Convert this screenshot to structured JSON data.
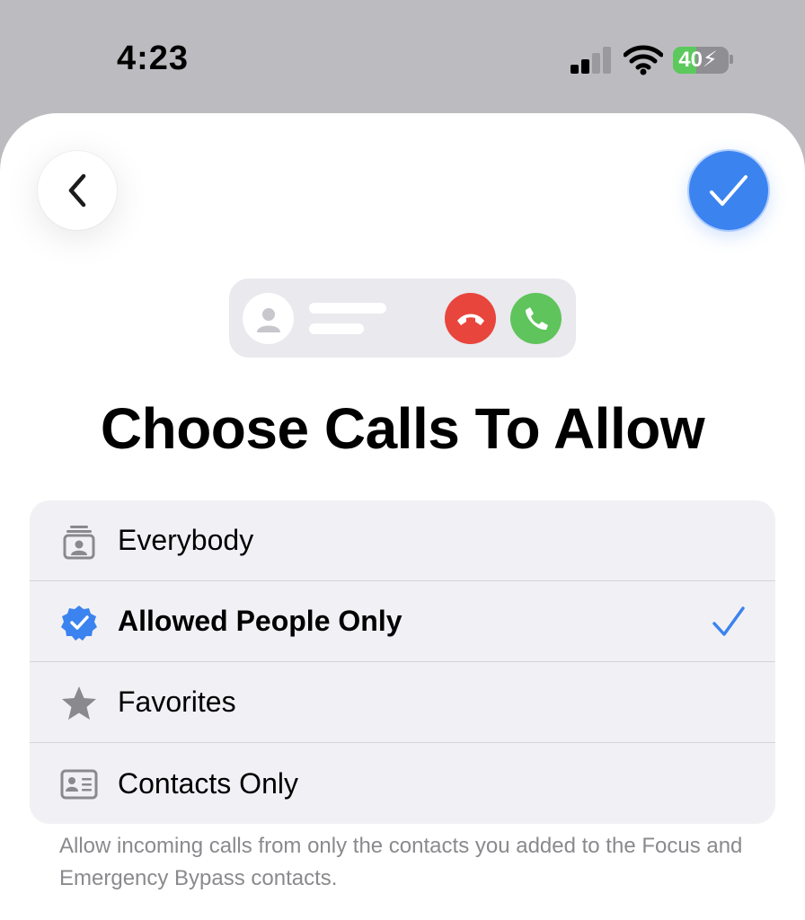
{
  "status_bar": {
    "time": "4:23",
    "battery_level": "40",
    "icons": [
      "cellular-signal-icon",
      "wifi-icon",
      "battery-charging-icon"
    ]
  },
  "nav": {
    "back_icon": "chevron-left-icon",
    "done_icon": "checkmark-icon"
  },
  "illustration": {
    "icons": [
      "person-icon",
      "decline-call-icon",
      "accept-call-icon"
    ]
  },
  "title": "Choose Calls To Allow",
  "options": [
    {
      "label": "Everybody",
      "icon": "contacts-stack-icon",
      "selected": false
    },
    {
      "label": "Allowed People Only",
      "icon": "verified-badge-icon",
      "selected": true
    },
    {
      "label": "Favorites",
      "icon": "star-icon",
      "selected": false
    },
    {
      "label": "Contacts Only",
      "icon": "contact-card-icon",
      "selected": false
    }
  ],
  "footer_note": "Allow incoming calls from only the contacts you added to the Focus and Emergency Bypass contacts.",
  "colors": {
    "accent": "#3b83ef",
    "decline": "#e8453c",
    "accept": "#5fc45b",
    "battery": "#5cc95c"
  }
}
